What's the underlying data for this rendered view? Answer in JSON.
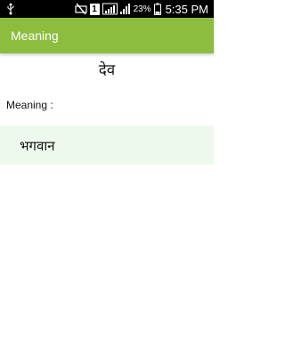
{
  "status_bar": {
    "icons": [
      "usb-icon",
      "mute-icon",
      "sim-1-icon",
      "signal-icon",
      "battery-icon"
    ],
    "sim_label": "1",
    "battery": "23%",
    "time": "5:35 PM",
    "colors": {
      "background": "#000000",
      "foreground": "#ffffff"
    }
  },
  "action_bar": {
    "title": "Meaning",
    "color": "#8cbd3f"
  },
  "content": {
    "word": "देव",
    "meaning_label": "Meaning :",
    "meaning": "भगवान",
    "meaning_background": "#eef9ee"
  }
}
